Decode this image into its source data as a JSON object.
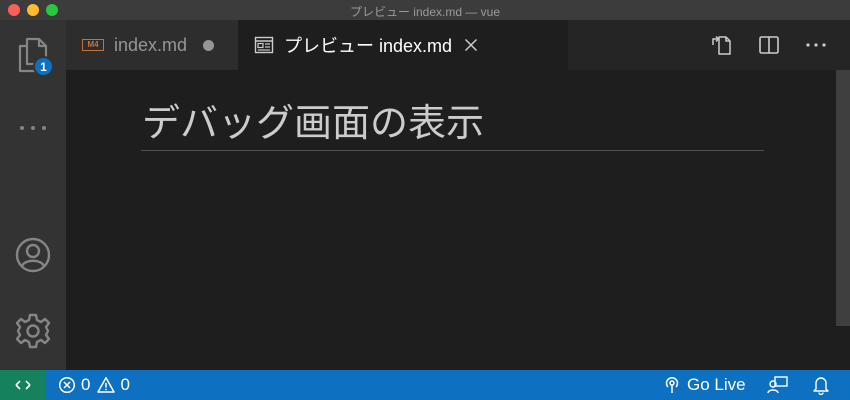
{
  "window": {
    "title": "プレビュー index.md — vue"
  },
  "activity_bar": {
    "explorer_badge": "1"
  },
  "tabs": [
    {
      "label": "index.md",
      "file_icon": "M4",
      "dirty": true,
      "active": false
    },
    {
      "label": "プレビュー index.md",
      "active": true
    }
  ],
  "preview": {
    "heading": "デバッグ画面の表示"
  },
  "status_bar": {
    "errors": "0",
    "warnings": "0",
    "go_live": "Go Live"
  },
  "colors": {
    "status_bar": "#0e70c0",
    "remote": "#16825d",
    "badge": "#0e70c0",
    "markdown_icon": "#c0733b"
  }
}
